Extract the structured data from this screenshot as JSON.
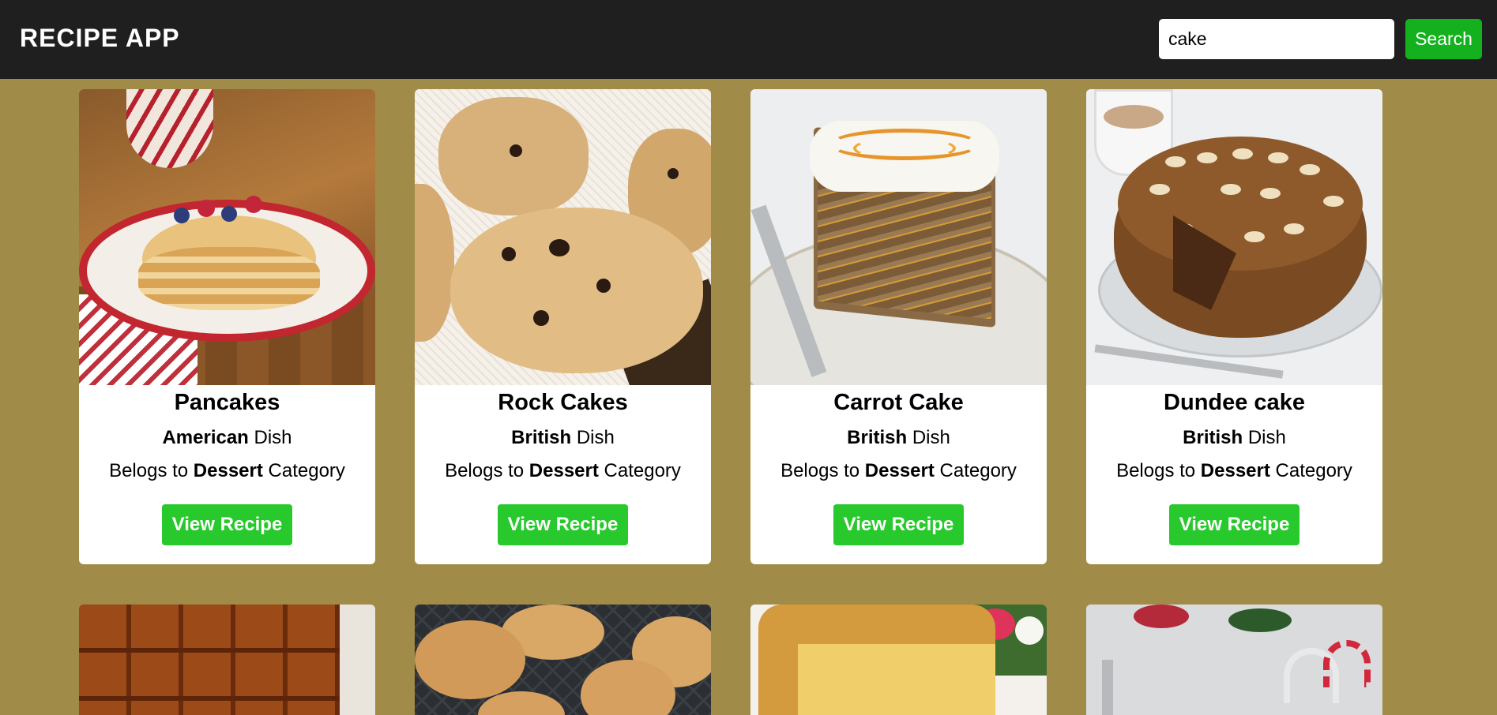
{
  "header": {
    "title": "RECIPE APP",
    "search_value": "cake",
    "search_button_label": "Search"
  },
  "recipes": [
    {
      "name": "Pancakes",
      "area": "American",
      "area_suffix": " Dish",
      "category_prefix": "Belogs to ",
      "category": "Dessert",
      "category_suffix": " Category",
      "button_label": "View Recipe"
    },
    {
      "name": "Rock Cakes",
      "area": "British",
      "area_suffix": " Dish",
      "category_prefix": "Belogs to ",
      "category": "Dessert",
      "category_suffix": " Category",
      "button_label": "View Recipe"
    },
    {
      "name": "Carrot Cake",
      "area": "British",
      "area_suffix": " Dish",
      "category_prefix": "Belogs to ",
      "category": "Dessert",
      "category_suffix": " Category",
      "button_label": "View Recipe"
    },
    {
      "name": "Dundee cake",
      "area": "British",
      "area_suffix": " Dish",
      "category_prefix": "Belogs to ",
      "category": "Dessert",
      "category_suffix": " Category",
      "button_label": "View Recipe"
    }
  ],
  "colors": {
    "page_background": "#a08b48",
    "header_background": "#1f1f1f",
    "search_button": "#14b11e",
    "view_button": "#28c92c"
  }
}
